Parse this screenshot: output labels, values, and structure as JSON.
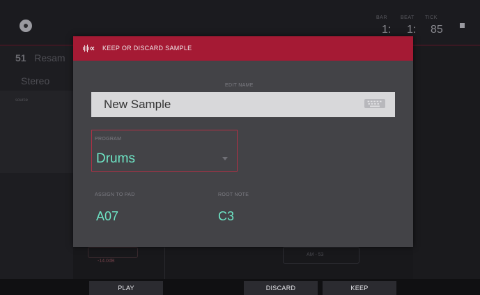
{
  "top": {
    "counters": [
      "1:",
      "1:",
      "85"
    ]
  },
  "background": {
    "track_num": "51",
    "track_name": "Resam",
    "mode": "Stereo",
    "side_label": "source",
    "level_readout": "-14.0dB",
    "ghost_text": "AM - 53"
  },
  "modal": {
    "title": "KEEP OR DISCARD SAMPLE",
    "edit_name_label": "EDIT NAME",
    "sample_name": "New Sample",
    "program_label": "PROGRAM",
    "program_value": "Drums",
    "assign_pad_label": "ASSIGN TO PAD",
    "assign_pad_value": "A07",
    "root_note_label": "ROOT NOTE",
    "root_note_value": "C3"
  },
  "buttons": {
    "play": "PLAY",
    "discard": "DISCARD",
    "keep": "KEEP"
  },
  "colors": {
    "accent_red": "#a51a34",
    "value_green": "#6ee6c6"
  }
}
